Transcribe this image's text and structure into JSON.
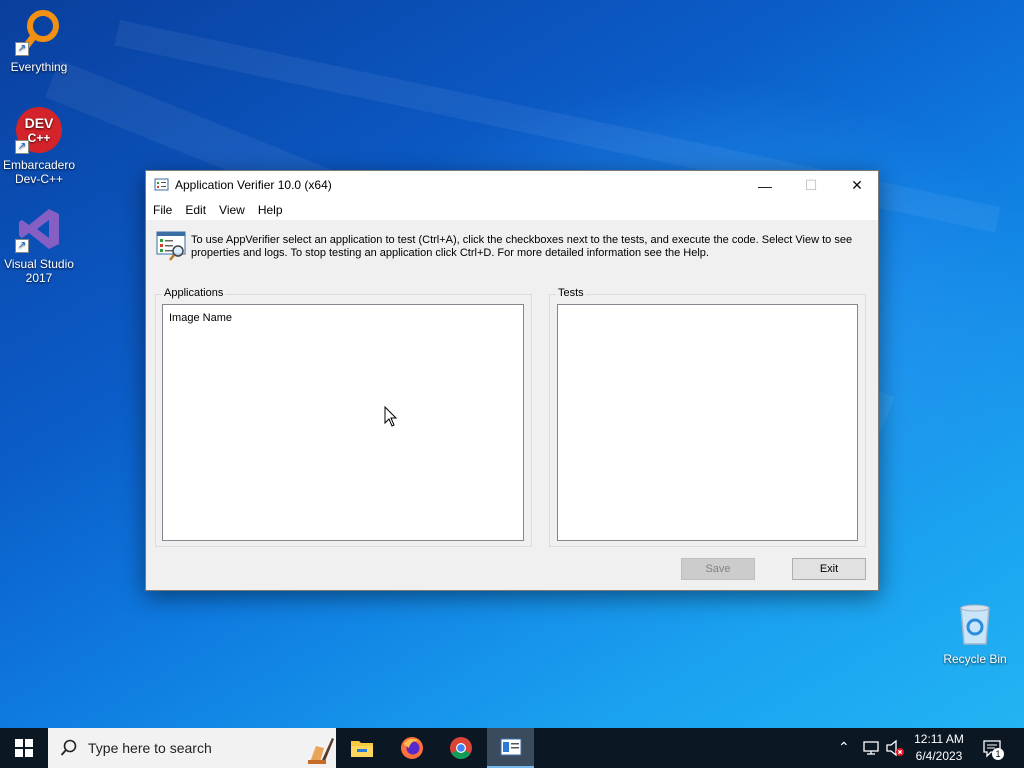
{
  "desktop": {
    "icons": [
      {
        "label": "Everything"
      },
      {
        "label": "Embarcadero Dev-C++",
        "line1": "Embarcadero",
        "line2": "Dev-C++",
        "badge": "DEV C++"
      },
      {
        "label": "Visual Studio 2017",
        "line1": "Visual Studio",
        "line2": "2017"
      },
      {
        "label": "Recycle Bin"
      }
    ]
  },
  "window": {
    "title": "Application Verifier 10.0 (x64)",
    "controls": {
      "minimize": "—",
      "maximize": "☐",
      "close": "✕"
    },
    "menu": [
      "File",
      "Edit",
      "View",
      "Help"
    ],
    "info_text": "To use AppVerifier select an application to test (Ctrl+A), click the checkboxes next to the tests, and execute the code. Select View to see properties and logs. To stop testing an application click Ctrl+D. For more detailed information see the Help.",
    "applications": {
      "label": "Applications",
      "column_header": "Image Name",
      "rows": []
    },
    "tests": {
      "label": "Tests",
      "rows": []
    },
    "buttons": {
      "save": "Save",
      "exit": "Exit"
    }
  },
  "taskbar": {
    "search_placeholder": "Type here to search",
    "pinned": [
      "File Explorer",
      "Firefox",
      "Google Chrome",
      "Application Verifier"
    ],
    "clock_time": "12:11 AM",
    "clock_date": "6/4/2023",
    "notification_count": "1"
  },
  "colors": {
    "accent": "#0078d7",
    "desktop": "#0b5cc8",
    "taskbar": "#0c1724"
  }
}
